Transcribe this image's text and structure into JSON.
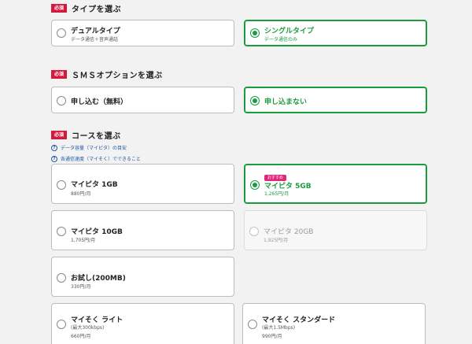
{
  "required_badge": "必須",
  "type_section": {
    "title": "タイプを選ぶ",
    "options": [
      {
        "label": "デュアルタイプ",
        "sub": "データ通信＋音声通話"
      },
      {
        "label": "シングルタイプ",
        "sub": "データ通信のみ"
      }
    ]
  },
  "sms_section": {
    "title": "ＳＭＳオプションを選ぶ",
    "options": [
      {
        "label": "申し込む（無料）"
      },
      {
        "label": "申し込まない"
      }
    ]
  },
  "course_section": {
    "title": "コースを選ぶ",
    "links": [
      "データ容量（マイピタ）の目安",
      "各通信速度（マイそく）でできること"
    ],
    "recommend_badge": "おすすめ",
    "options": [
      {
        "label": "マイピタ 1GB",
        "sub": "880円/月"
      },
      {
        "label": "マイピタ 5GB",
        "sub": "1,265円/月"
      },
      {
        "label": "マイピタ 10GB",
        "sub": "1,705円/月"
      },
      {
        "label": "マイピタ 20GB",
        "sub": "1,925円/月"
      },
      {
        "label": "お試し(200MB)",
        "sub": "330円/月"
      },
      {
        "label": "マイそく ライト",
        "sub1": "(最大300kbps)",
        "sub2": "660円/月"
      },
      {
        "label": "マイそく スタンダード",
        "sub1": "(最大1.5Mbps)",
        "sub2": "990円/月"
      }
    ]
  },
  "colors": {
    "selected": "#1a9c3e",
    "required": "#d6183c",
    "recommend": "#e0287a",
    "link": "#1f5aa6"
  }
}
